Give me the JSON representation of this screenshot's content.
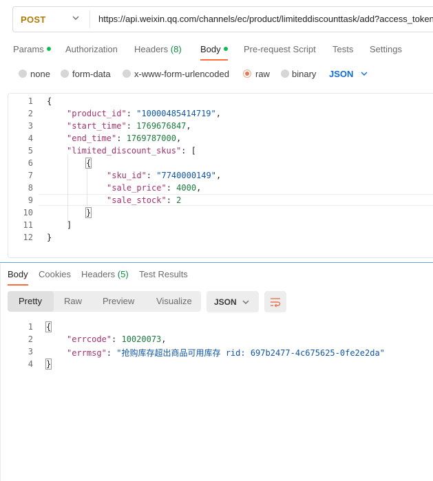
{
  "request": {
    "method": "POST",
    "url": "https://api.weixin.qq.com/channels/ec/product/limiteddiscounttask/add?access_token"
  },
  "request_tabs": [
    {
      "label": "Params",
      "dot": true
    },
    {
      "label": "Authorization"
    },
    {
      "label": "Headers",
      "count": "(8)"
    },
    {
      "label": "Body",
      "dot": true,
      "active": true
    },
    {
      "label": "Pre-request Script"
    },
    {
      "label": "Tests"
    },
    {
      "label": "Settings"
    }
  ],
  "body_types": {
    "none": "none",
    "form_data": "form-data",
    "urlencoded": "x-www-form-urlencoded",
    "raw": "raw",
    "binary": "binary",
    "selected": "raw",
    "format": "JSON"
  },
  "editor": {
    "line_numbers": [
      "1",
      "2",
      "3",
      "4",
      "5",
      "6",
      "7",
      "8",
      "9",
      "10",
      "11",
      "12"
    ],
    "lines": [
      "{",
      "\"product_id\": \"10000485414719\",",
      "\"start_time\": 1769676847,",
      "\"end_time\": 1769787000,",
      "\"limited_discount_skus\": [",
      "{",
      "\"sku_id\": \"7740000149\",",
      "\"sale_price\": 4000,",
      "\"sale_stock\": 2",
      "}",
      "]",
      "}"
    ]
  },
  "response_tabs": [
    {
      "label": "Body",
      "active": true
    },
    {
      "label": "Cookies"
    },
    {
      "label": "Headers",
      "count": "(5)"
    },
    {
      "label": "Test Results"
    }
  ],
  "view_modes": [
    "Pretty",
    "Raw",
    "Preview",
    "Visualize"
  ],
  "response_format": "JSON",
  "response": {
    "line_numbers": [
      "1",
      "2",
      "3",
      "4"
    ],
    "lines": [
      "{",
      "\"errcode\": 10020073,",
      "\"errmsg\": \"抢购库存超出商品可用库存 rid: 697b2477-4c675625-0fe2e2da\"",
      "}"
    ]
  },
  "colors": {
    "accent": "#ff6c37",
    "json_key": "#a4316e",
    "json_string": "#0e55a6",
    "json_number": "#1a7a3a",
    "method": "#ad7a03",
    "link_blue": "#0f6bd9",
    "status_dot": "#0cbb52"
  }
}
